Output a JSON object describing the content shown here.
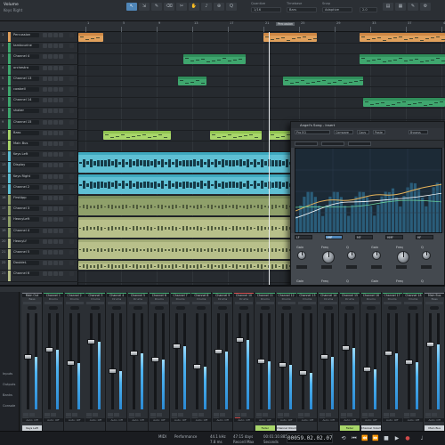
{
  "toolbar": {
    "track_name": "Volume",
    "track_sub": "Keys Right",
    "tools": [
      "↖",
      "⇲",
      "✎",
      "⌫",
      "✂",
      "✋",
      "♪",
      "⊕",
      "Q"
    ],
    "quantize_label": "Quantize",
    "quantize_value": "1/16",
    "timebase_label": "Timebase",
    "timebase_value": "Bars",
    "snap_label": "Snap",
    "snap_value": "Adaptive",
    "zoom": "2.0"
  },
  "arrange": {
    "ruler_marks": [
      "1",
      "5",
      "9",
      "13",
      "17",
      "21",
      "25",
      "29",
      "33",
      "37",
      "41"
    ],
    "marker_label": "Percussion",
    "tracks": [
      {
        "num": "1",
        "name": "Percussion",
        "color": "#e0a05c"
      },
      {
        "num": "2",
        "name": "tambourine",
        "color": "#3fa66e"
      },
      {
        "num": "3",
        "name": "Channel 4",
        "color": "#3fa66e"
      },
      {
        "num": "4",
        "name": "orchestra",
        "color": "#3fa66e"
      },
      {
        "num": "5",
        "name": "Channel 13",
        "color": "#3fa66e"
      },
      {
        "num": "6",
        "name": "cowbell",
        "color": "#3fa66e"
      },
      {
        "num": "7",
        "name": "Channel 14",
        "color": "#3fa66e"
      },
      {
        "num": "8",
        "name": "shaker",
        "color": "#3fa66e"
      },
      {
        "num": "9",
        "name": "Channel 15",
        "color": "#3fa66e"
      },
      {
        "num": "10",
        "name": "Bass",
        "color": "#a8d66a"
      },
      {
        "num": "11",
        "name": "Main Bus",
        "color": "#a8d66a"
      },
      {
        "num": "12",
        "name": "Keys Left",
        "color": "#5fc0d4"
      },
      {
        "num": "13",
        "name": "Display",
        "color": "#5fc0d4"
      },
      {
        "num": "14",
        "name": "Keys Right",
        "color": "#5fc0d4"
      },
      {
        "num": "15",
        "name": "Channel 2",
        "color": "#5fc0d4"
      },
      {
        "num": "16",
        "name": "FirstApp",
        "color": "#8fa06a"
      },
      {
        "num": "17",
        "name": "Channel 3",
        "color": "#8fa06a"
      },
      {
        "num": "18",
        "name": "HeavyLeft",
        "color": "#8fa06a"
      },
      {
        "num": "19",
        "name": "Channel 4",
        "color": "#8fa06a"
      },
      {
        "num": "20",
        "name": "HeavyLf",
        "color": "#b8c08a"
      },
      {
        "num": "21",
        "name": "Channel 5",
        "color": "#b8c08a"
      },
      {
        "num": "22",
        "name": "DoubleL",
        "color": "#b8c08a"
      },
      {
        "num": "23",
        "name": "Channel 6",
        "color": "#b8c08a"
      }
    ]
  },
  "plugin": {
    "title": "Angel's Song - Insert",
    "preset": "Pro EQ",
    "compare_label": "Compare",
    "copy_label": "Copy",
    "paste_label": "Paste",
    "bypass_label": "Bypass",
    "knob_labels": [
      "Gain",
      "Freq",
      "Q",
      "Gain",
      "Freq",
      "Q",
      "Gain",
      "Freq",
      "Q",
      "Gain",
      "Freq",
      "Q"
    ],
    "band_labels": [
      "LF",
      "LMF",
      "MF",
      "HMF",
      "HF"
    ],
    "auto_label": "Auto"
  },
  "mixer": {
    "sidebar": [
      "Inputs",
      "Outputs",
      "Banks",
      "Console"
    ],
    "channels": [
      {
        "name": "Main Out",
        "sub": "Bass",
        "color": "#7a8088",
        "label": "Keys Left",
        "level": 0.55
      },
      {
        "name": "Channel 1",
        "sub": "Drums",
        "color": "#3fa66e",
        "label": "",
        "level": 0.62
      },
      {
        "name": "Channel 2",
        "sub": "Drums",
        "color": "#3fa66e",
        "label": "",
        "level": 0.48
      },
      {
        "name": "Channel 3",
        "sub": "Drums",
        "color": "#3fa66e",
        "label": "",
        "level": 0.7
      },
      {
        "name": "Channel 4",
        "sub": "Drums",
        "color": "#3fa66e",
        "label": "",
        "level": 0.4
      },
      {
        "name": "Channel 5",
        "sub": "Drums",
        "color": "#3fa66e",
        "label": "",
        "level": 0.58
      },
      {
        "name": "Channel 6",
        "sub": "Drums",
        "color": "#3fa66e",
        "label": "",
        "level": 0.52
      },
      {
        "name": "Channel 7",
        "sub": "Drums",
        "color": "#3fa66e",
        "label": "",
        "level": 0.66
      },
      {
        "name": "Channel 8",
        "sub": "Drums",
        "color": "#3fa66e",
        "label": "",
        "level": 0.44
      },
      {
        "name": "Channel 9",
        "sub": "Drums",
        "color": "#3fa66e",
        "label": "",
        "level": 0.6
      },
      {
        "name": "Channel 10",
        "sub": "Drums",
        "color": "#d15050",
        "label": "",
        "level": 0.72
      },
      {
        "name": "Channel 11",
        "sub": "Drums",
        "color": "#3fa66e",
        "label": "Fader",
        "level": 0.5
      },
      {
        "name": "Channel 12",
        "sub": "Drums",
        "color": "#3fa66e",
        "label": "Channel Volume",
        "level": 0.46
      },
      {
        "name": "Channel 13",
        "sub": "Drums",
        "color": "#3fa66e",
        "label": "",
        "level": 0.38
      },
      {
        "name": "Channel 14",
        "sub": "Drums",
        "color": "#3fa66e",
        "label": "",
        "level": 0.55
      },
      {
        "name": "Channel 15",
        "sub": "Drums",
        "color": "#3fa66e",
        "label": "Fader",
        "level": 0.64
      },
      {
        "name": "Channel 16",
        "sub": "Drums",
        "color": "#3fa66e",
        "label": "Channel Volume",
        "level": 0.42
      },
      {
        "name": "Channel 17",
        "sub": "Drums",
        "color": "#3fa66e",
        "label": "",
        "level": 0.58
      },
      {
        "name": "Channel 18",
        "sub": "Drums",
        "color": "#3fa66e",
        "label": "",
        "level": 0.49
      },
      {
        "name": "Main Bus",
        "sub": "Bass",
        "color": "#7a8088",
        "label": "Main Bus",
        "level": 0.68
      }
    ],
    "auto_off": "Auto: Off"
  },
  "transport": {
    "midi_label": "MIDI",
    "perf_label": "Performance",
    "sample_rate": "44.1 kHz",
    "latency": "7.8 ms",
    "record_time": "47:15 days",
    "record_label": "Record Max",
    "position": "00:01:10.885",
    "seconds_label": "Seconds",
    "bars": "00059.02.02.07",
    "bars_label": "Bars"
  }
}
